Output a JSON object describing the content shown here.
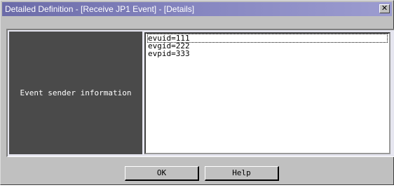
{
  "window": {
    "title": "Detailed Definition - [Receive JP1 Event] - [Details]",
    "close_glyph": "✕"
  },
  "panel": {
    "label": "Event sender information",
    "text_lines": [
      "evuid=111",
      "evgid=222",
      "evpid=333"
    ]
  },
  "buttons": {
    "ok_label": "OK",
    "help_label": "Help"
  },
  "colors": {
    "titlebar": "#8686c0",
    "dialog_bg": "#c0c0c0",
    "label_bg": "#4a4a4a"
  }
}
